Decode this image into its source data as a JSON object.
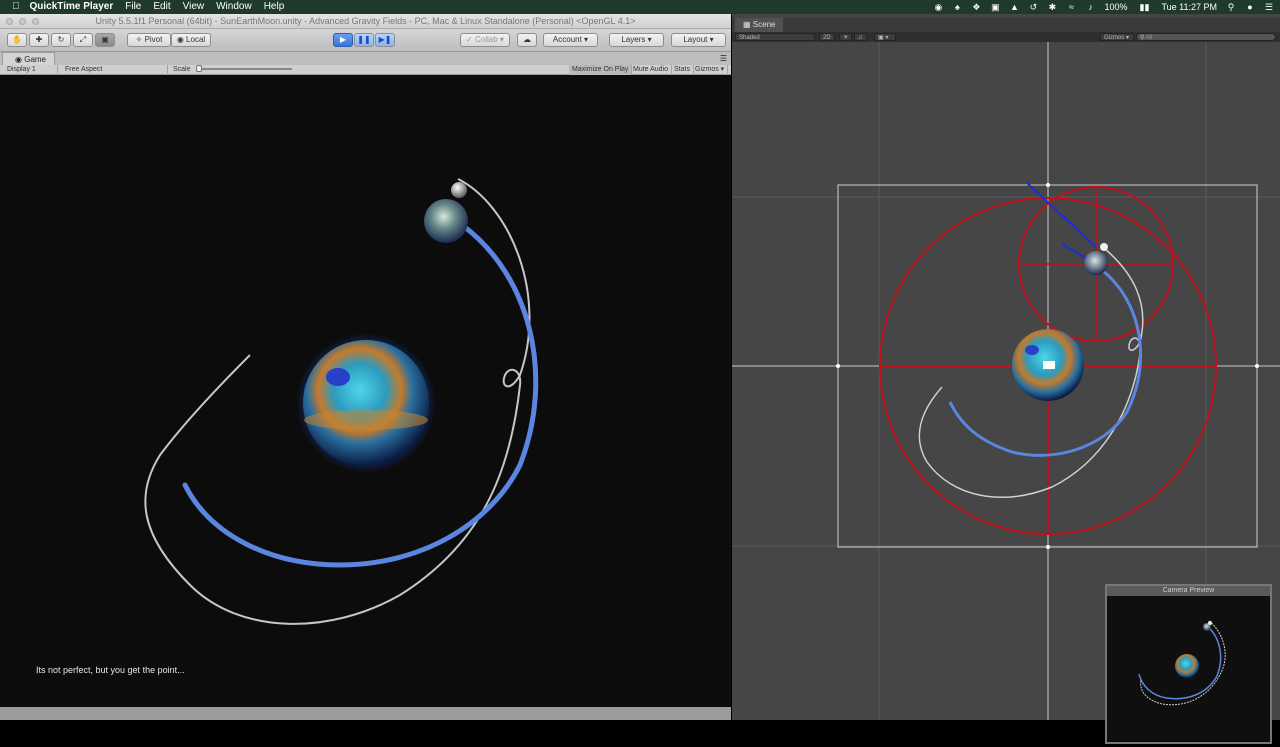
{
  "menubar": {
    "app": "QuickTime Player",
    "items": [
      "File",
      "Edit",
      "View",
      "Window",
      "Help"
    ],
    "battery": "100%",
    "clock": "Tue 11:27 PM"
  },
  "unity": {
    "title": "Unity 5.5.1f1 Personal (64bit) - SunEarthMoon.unity - Advanced Gravity Fields - PC, Mac & Linux Standalone (Personal) <OpenGL 4.1>",
    "pivot_label": "Pivot",
    "local_label": "Local",
    "collab_label": "Collab",
    "account_label": "Account",
    "layers_label": "Layers",
    "layout_label": "Layout",
    "game_tab": "Game",
    "display_label": "Display 1",
    "aspect_label": "Free Aspect",
    "scale_label": "Scale",
    "scale_value": "1x",
    "maximize_label": "Maximize On Play",
    "mute_label": "Mute Audio",
    "stats_label": "Stats",
    "gizmos_label": "Gizmos",
    "caption": "Its not perfect, but you get the point..."
  },
  "scene": {
    "tab": "Scene",
    "shading": "Shaded",
    "mode_2d": "2D",
    "gizmos_label": "Gizmos",
    "search_placeholder": "All",
    "camera_preview": "Camera Preview"
  },
  "colors": {
    "accent": "#3a74d8",
    "orbit_blue": "#5b86e0",
    "orbit_white": "#e8e8e8",
    "gizmo_red": "#c0101c",
    "gizmo_blue": "#1a2fd8"
  }
}
